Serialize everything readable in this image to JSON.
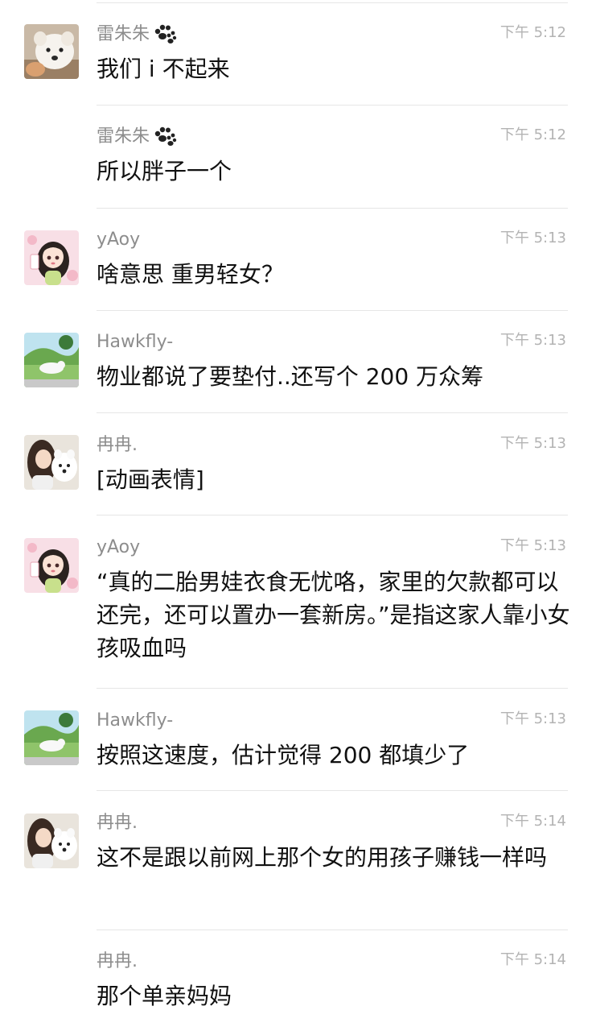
{
  "messages": [
    {
      "sender": "雷朱朱",
      "time": "下午 5:12",
      "text": "我们 i 不起来",
      "avatar": "samoyed-puppy-avatar",
      "show_avatar": true,
      "paw": true
    },
    {
      "sender": "雷朱朱",
      "time": "下午 5:12",
      "text": "所以胖子一个",
      "avatar": "",
      "show_avatar": false,
      "paw": true
    },
    {
      "sender": "yAoy",
      "time": "下午 5:13",
      "text": "啥意思 重男轻女？",
      "avatar": "cartoon-girl-avatar",
      "show_avatar": true,
      "paw": false
    },
    {
      "sender": "Hawkfly-",
      "time": "下午 5:13",
      "text": "物业都说了要垫付..还写个 200 万众筹",
      "avatar": "cartoon-landscape-avatar",
      "show_avatar": true,
      "paw": false
    },
    {
      "sender": "冉冉.",
      "time": "下午 5:13",
      "text": "[动画表情]",
      "avatar": "girl-with-dog-avatar",
      "show_avatar": true,
      "paw": false
    },
    {
      "sender": "yAoy",
      "time": "下午 5:13",
      "text": "“真的二胎男娃衣食无忧咯，家里的欠款都可以还完，还可以置办一套新房。”是指这家人靠小女孩吸血吗",
      "avatar": "cartoon-girl-avatar",
      "show_avatar": true,
      "paw": false
    },
    {
      "sender": "Hawkfly-",
      "time": "下午 5:13",
      "text": "按照这速度，估计觉得 200 都填少了",
      "avatar": "cartoon-landscape-avatar",
      "show_avatar": true,
      "paw": false
    },
    {
      "sender": "冉冉.",
      "time": "下午 5:14",
      "text": "这不是跟以前网上那个女的用孩子赚钱一样吗",
      "avatar": "girl-with-dog-avatar",
      "show_avatar": true,
      "paw": false
    },
    {
      "sender": "冉冉.",
      "time": "下午 5:14",
      "text": "那个单亲妈妈",
      "avatar": "",
      "show_avatar": false,
      "paw": false
    }
  ],
  "colors": {
    "background": "#ffffff",
    "sender_text": "#8d8d8d",
    "time_text": "#b3b3b3",
    "message_text": "#111111",
    "divider": "#e6e6e6"
  }
}
